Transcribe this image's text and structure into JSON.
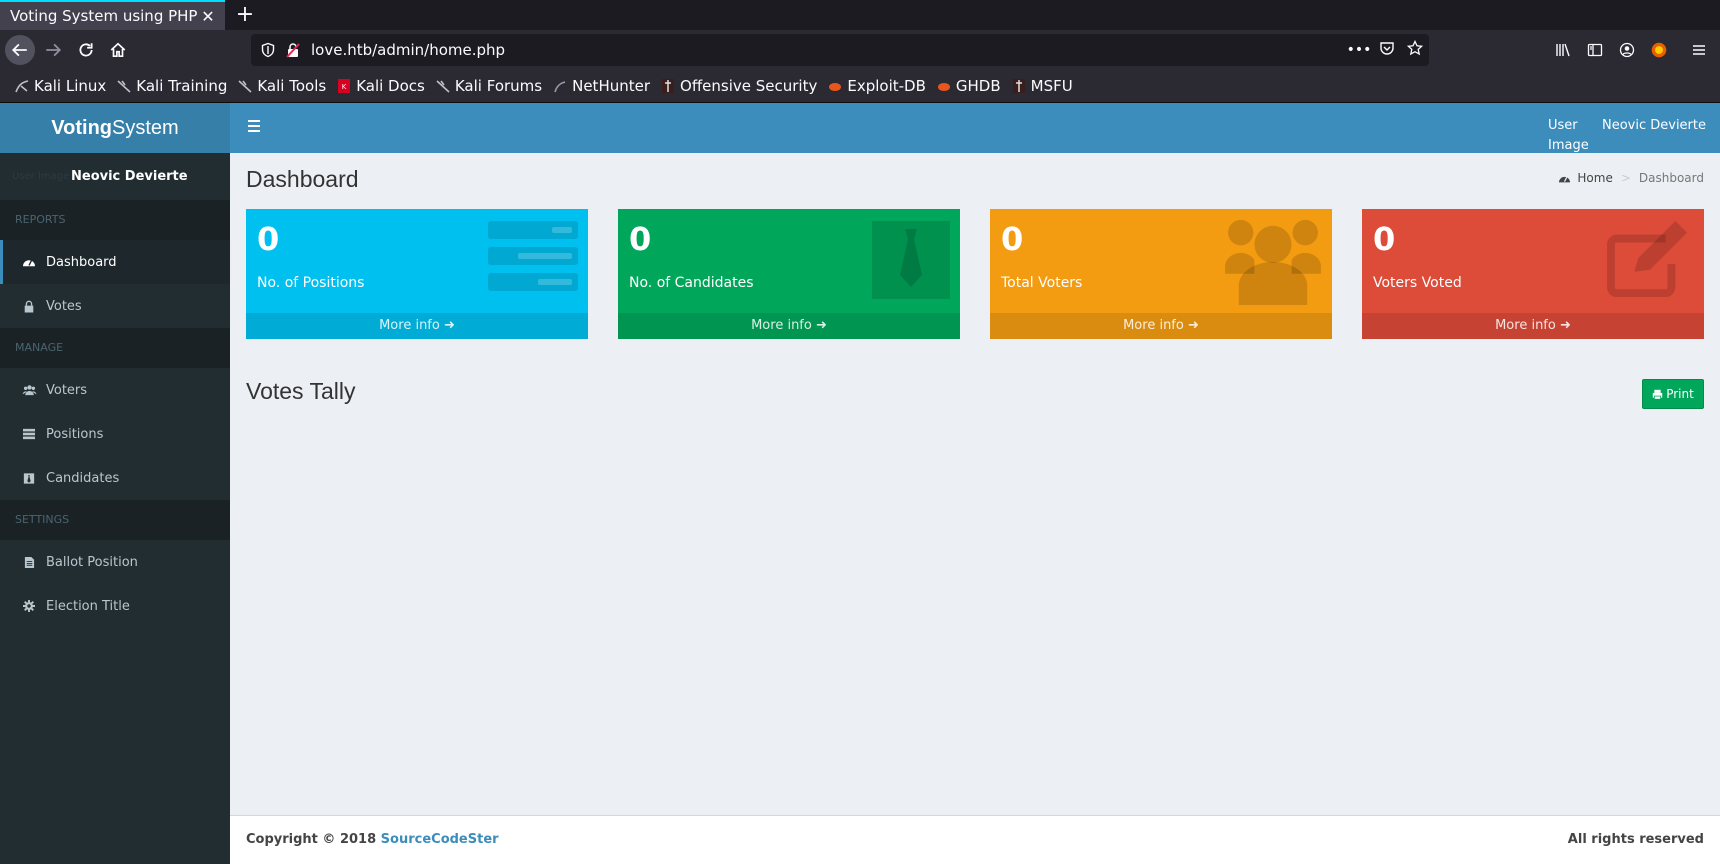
{
  "browser": {
    "tab_title": "Voting System using PHP",
    "url": "love.htb/admin/home.php",
    "bookmarks": [
      {
        "label": "Kali Linux",
        "icon": "kali-icon"
      },
      {
        "label": "Kali Training",
        "icon": "kali-icon"
      },
      {
        "label": "Kali Tools",
        "icon": "kali-icon"
      },
      {
        "label": "Kali Docs",
        "icon": "docs-icon"
      },
      {
        "label": "Kali Forums",
        "icon": "kali-icon"
      },
      {
        "label": "NetHunter",
        "icon": "nethunter-icon"
      },
      {
        "label": "Offensive Security",
        "icon": "offsec-icon"
      },
      {
        "label": "Exploit-DB",
        "icon": "exploitdb-icon"
      },
      {
        "label": "GHDB",
        "icon": "exploitdb-icon"
      },
      {
        "label": "MSFU",
        "icon": "offsec-icon"
      }
    ]
  },
  "app": {
    "logo_bold": "Voting",
    "logo_rest": "System",
    "user_image_alt": "User Image",
    "user_name": "Neovic Devierte"
  },
  "sidebar": {
    "user_image_alt": "User Image",
    "user_name": "Neovic Devierte",
    "sections": {
      "reports": "REPORTS",
      "manage": "MANAGE",
      "settings": "SETTINGS"
    },
    "items": {
      "dashboard": "Dashboard",
      "votes": "Votes",
      "voters": "Voters",
      "positions": "Positions",
      "candidates": "Candidates",
      "ballot": "Ballot Position",
      "election": "Election Title"
    }
  },
  "main": {
    "title": "Dashboard",
    "breadcrumb_home": "Home",
    "breadcrumb_current": "Dashboard",
    "boxes": [
      {
        "value": "0",
        "label": "No. of Positions",
        "more": "More info",
        "color": "#00c0ef"
      },
      {
        "value": "0",
        "label": "No. of Candidates",
        "more": "More info",
        "color": "#00a65a"
      },
      {
        "value": "0",
        "label": "Total Voters",
        "more": "More info",
        "color": "#f39c12"
      },
      {
        "value": "0",
        "label": "Voters Voted",
        "more": "More info",
        "color": "#dd4b39"
      }
    ],
    "tally_title": "Votes Tally",
    "print_label": "Print"
  },
  "footer": {
    "copyright": "Copyright © 2018",
    "link": "SourceCodeSter",
    "rights": "All rights reserved"
  }
}
